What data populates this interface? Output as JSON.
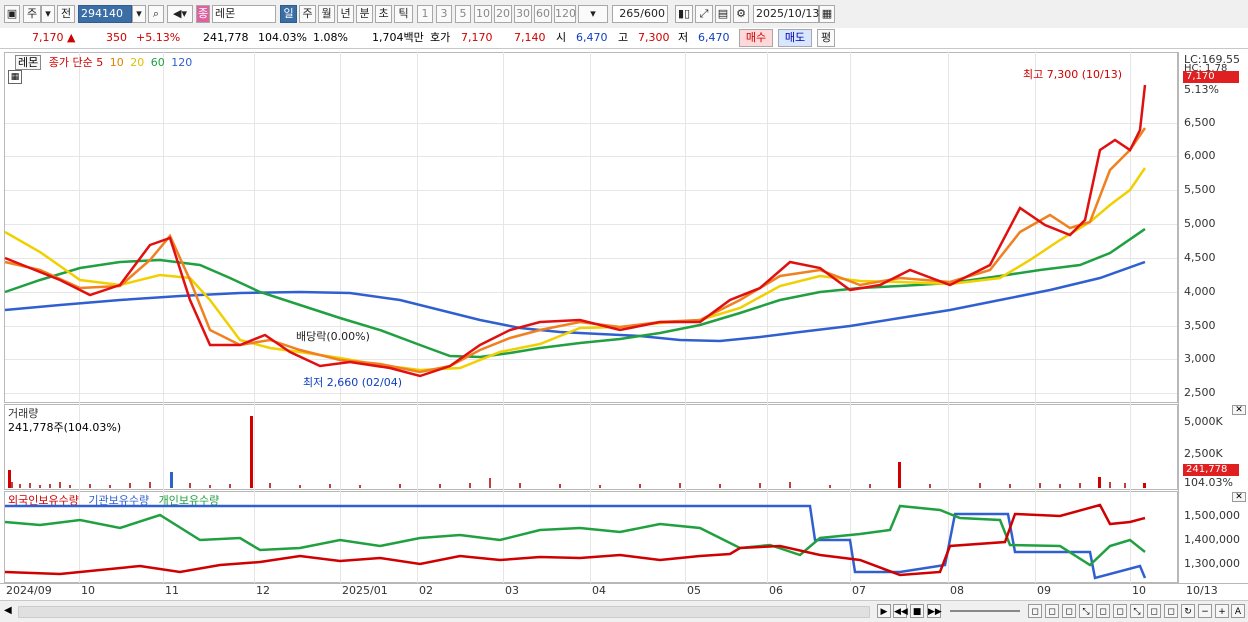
{
  "toolbar": {
    "market": "주",
    "prev": "전",
    "code": "294140",
    "name_prefix": "종",
    "name": "레몬",
    "periods": [
      "일",
      "주",
      "월",
      "년",
      "분",
      "초",
      "틱"
    ],
    "periods_selected": "일",
    "minute_values": [
      "1",
      "3",
      "5",
      "10",
      "20",
      "30",
      "60",
      "120"
    ],
    "count": "265",
    "count_total": "/600",
    "date": "2025/10/13"
  },
  "info": {
    "price": "7,170",
    "arrow": "▲",
    "change": "350",
    "change_pct": "+5.13%",
    "volume": "241,778",
    "volume_ratio": "104.03%",
    "turnover": "1.08%",
    "trade_amount": "1,704백만",
    "quote_label": "호가",
    "ask": "7,170",
    "bid": "7,140",
    "open_label": "시",
    "open": "6,470",
    "high_label": "고",
    "high": "7,300",
    "low_label": "저",
    "low": "6,470",
    "buy_button": "매수",
    "sell_button": "매도",
    "eval_button": "평"
  },
  "price_panel": {
    "stock_label": "레몬",
    "ma_legend": [
      "종가 단순",
      "5",
      "10",
      "20",
      "60",
      "120"
    ],
    "ma_colors": [
      "#d00000",
      "#d00000",
      "#e08000",
      "#e0c000",
      "#20a040",
      "#3060d0"
    ],
    "max_annotation": "최고 7,300 (10/13)",
    "min_annotation": "최저 2,660 (02/04)",
    "dividend_annotation": "배당락(0.00%)",
    "lc_label": "LC:169.55",
    "hc_label": "HC: 1.78",
    "price_tag": "7,170",
    "pct_tag": "5.13%",
    "y_labels": [
      "6,500",
      "6,000",
      "5,500",
      "5,000",
      "4,500",
      "4,000",
      "3,500",
      "3,000",
      "2,500"
    ]
  },
  "volume_panel": {
    "title": "거래량",
    "value": "241,778주(104.03%)",
    "y_labels": [
      "5,000K",
      "2,500K"
    ],
    "tag": "241,778",
    "tag_pct": "104.03%"
  },
  "holding_panel": {
    "legend": [
      "외국인보유수량",
      "기관보유수량",
      "개인보유수량"
    ],
    "colors": [
      "#d00000",
      "#3060d0",
      "#20a040"
    ],
    "y_labels": [
      "1,500,000",
      "1,400,000",
      "1,300,000"
    ]
  },
  "x_labels": [
    "2024/09",
    "10",
    "11",
    "12",
    "2025/01",
    "02",
    "03",
    "04",
    "05",
    "06",
    "07",
    "08",
    "09",
    "10"
  ],
  "x_end_label": "10/13"
}
